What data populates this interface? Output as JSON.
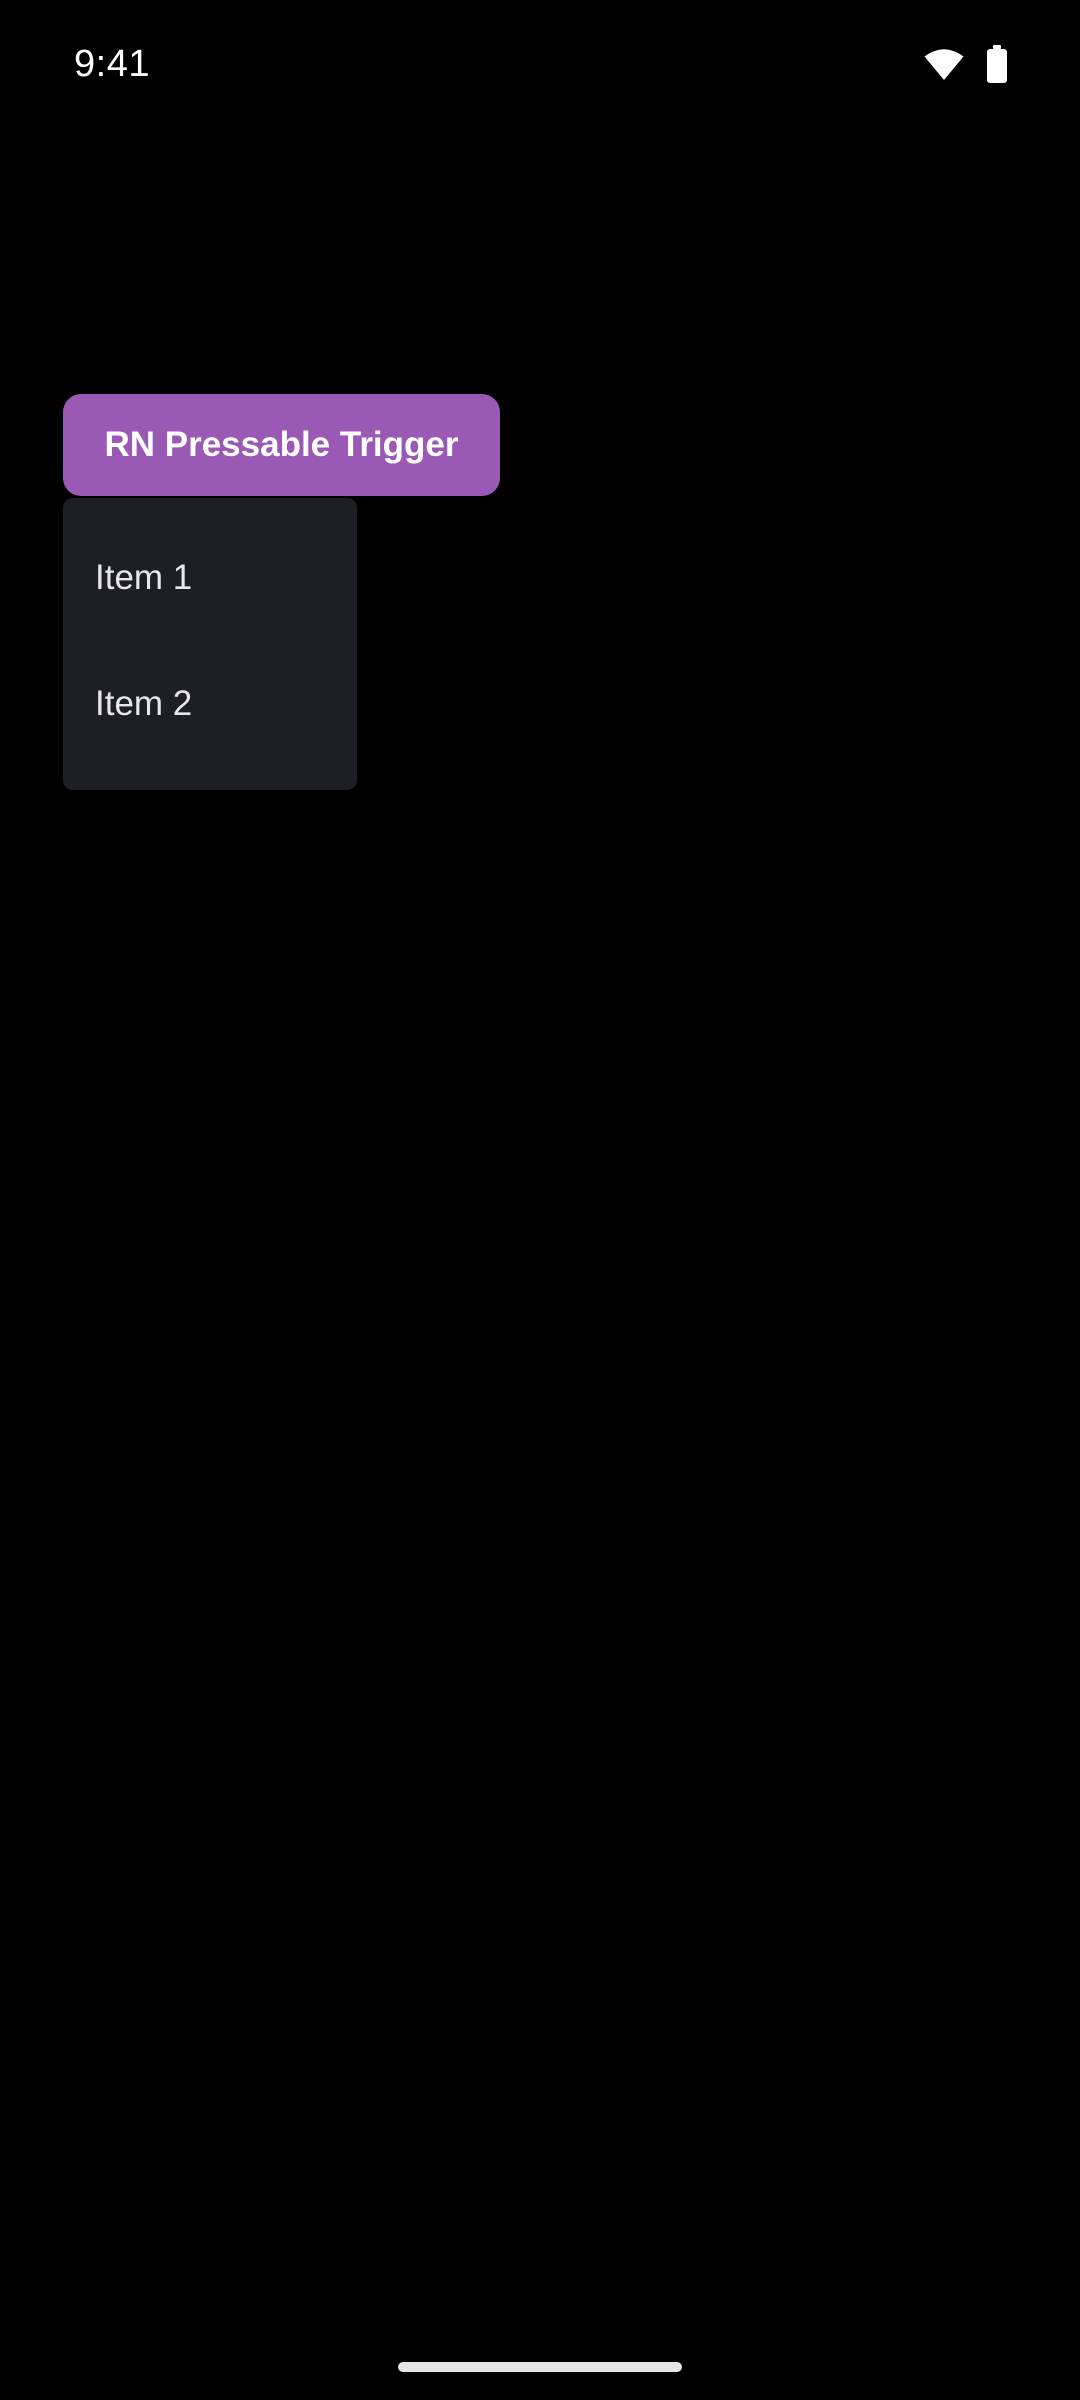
{
  "status_bar": {
    "time": "9:41",
    "icons": [
      "wifi-icon",
      "battery-icon"
    ]
  },
  "trigger": {
    "label": "RN Pressable Trigger"
  },
  "menu": {
    "items": [
      {
        "label": "Item 1"
      },
      {
        "label": "Item 2"
      }
    ]
  },
  "colors": {
    "background": "#000000",
    "accent": "#9b59b6",
    "menu_background": "#1e1f24",
    "text": "#ffffff",
    "menu_text": "#e8e8ea",
    "home_indicator": "#e6e6e6"
  }
}
